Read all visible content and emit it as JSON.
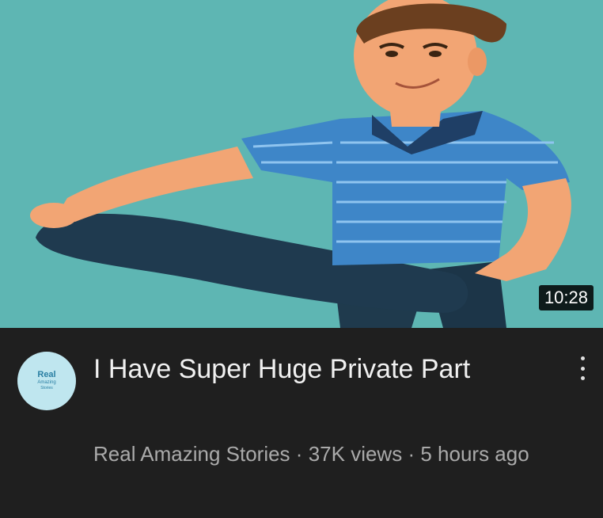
{
  "video": {
    "duration": "10:28",
    "title": "I Have Super Huge Private Part",
    "channel": "Real Amazing Stories",
    "views": "37K views",
    "age": "5 hours ago",
    "separator": "·"
  },
  "avatar": {
    "line1": "Real",
    "line2": "Amazing",
    "line3": "Stories"
  },
  "colors": {
    "thumbnail_background": "#5eb6b3",
    "card_background": "#1f1f1f",
    "title_text": "#f1f1f1",
    "meta_text": "#aaaaaa"
  },
  "icons": {
    "more": "vertical-ellipsis-icon"
  }
}
